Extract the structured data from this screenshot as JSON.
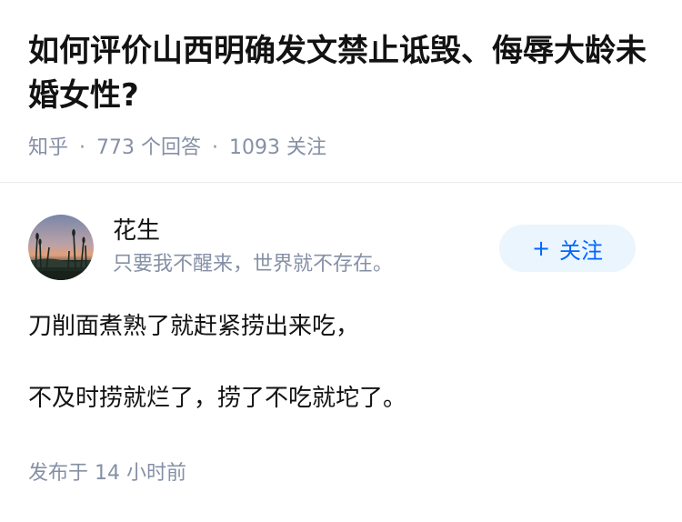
{
  "question": {
    "title": "如何评价山西明确发文禁止诋毁、侮辱大龄未婚女性?",
    "source": "知乎",
    "answer_count": "773 个回答",
    "follower_count": "1093 关注",
    "separator": "·"
  },
  "author": {
    "name": "花生",
    "bio": "只要我不醒来，世界就不存在。",
    "avatar_icon": "avatar-sunset-photo",
    "follow_label": "关注",
    "follow_icon": "plus-icon"
  },
  "answer": {
    "paragraphs": [
      "刀削面煮熟了就赶紧捞出来吃，",
      "不及时捞就烂了，捞了不吃就坨了。"
    ],
    "published": "发布于  14 小时前"
  },
  "colors": {
    "title": "#121212",
    "meta": "#8590a6",
    "accent": "#0066ff",
    "follow_bg": "#ebf5fd"
  }
}
